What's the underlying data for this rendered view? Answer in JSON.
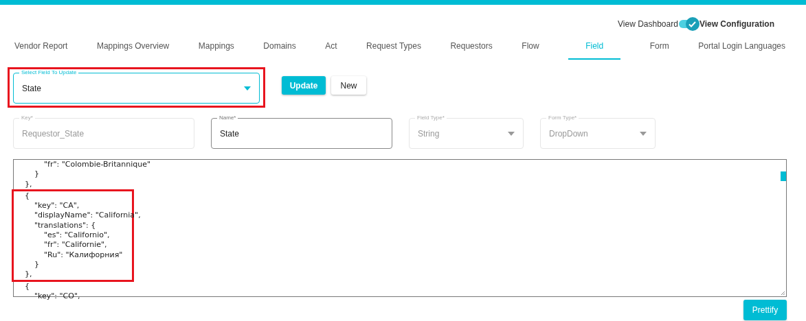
{
  "view_switch": {
    "left_label": "View Dashboard",
    "right_label": "View Configuration",
    "on": true
  },
  "tabs": [
    {
      "label": "Vendor Report",
      "selected": false
    },
    {
      "label": "Mappings Overview",
      "selected": false
    },
    {
      "label": "Mappings",
      "selected": false
    },
    {
      "label": "Domains",
      "selected": false
    },
    {
      "label": "Act",
      "selected": false
    },
    {
      "label": "Request Types",
      "selected": false
    },
    {
      "label": "Requestors",
      "selected": false
    },
    {
      "label": "Flow",
      "selected": false
    },
    {
      "label": "Field",
      "selected": true
    },
    {
      "label": "Form",
      "selected": false
    },
    {
      "label": "Portal Login Languages",
      "selected": false
    }
  ],
  "field_select": {
    "label": "Select Field To Update",
    "value": "State"
  },
  "buttons": [
    {
      "label": "Update",
      "kind": "primary"
    },
    {
      "label": "New",
      "kind": "secondary"
    }
  ],
  "fields": [
    {
      "label": "Key*",
      "value": "Requestor_State",
      "kind": "text",
      "disabled": true
    },
    {
      "label": "Name*",
      "value": "State",
      "kind": "text",
      "disabled": false
    },
    {
      "label": "Field Type*",
      "value": "String",
      "kind": "select",
      "disabled": true
    },
    {
      "label": "Form Type*",
      "value": "DropDown",
      "kind": "select",
      "disabled": true
    }
  ],
  "editor": {
    "lines_before": [
      "            \"fr\": \"Colombie-Britannique\"",
      "        }",
      "    },"
    ],
    "highlighted_lines": [
      "    {",
      "        \"key\": \"CA\",",
      "        \"displayName\": \"California\",",
      "        \"translations\": {",
      "            \"es\": \"Californio\",",
      "            \"fr\": \"Californie\",",
      "            \"Ru\": \"Калифорния\"",
      "        }",
      "    },"
    ],
    "lines_after": [
      "    {",
      "        \"key\": \"CO\","
    ]
  },
  "prettify_button": "Prettify"
}
